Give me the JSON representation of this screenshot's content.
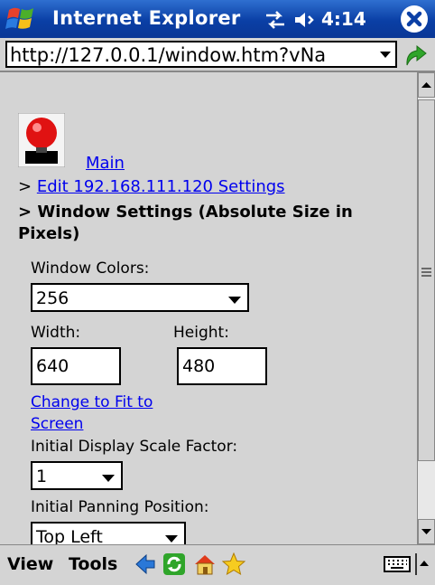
{
  "window": {
    "title": "Internet Explorer",
    "clock": "4:14"
  },
  "address": {
    "url": "http://127.0.0.1/window.htm?vNa"
  },
  "breadcrumb": {
    "main": "Main",
    "prefix": ">",
    "edit": "Edit 192.168.111.120 Settings",
    "current": "> Window Settings (Absolute Size in Pixels)"
  },
  "form": {
    "window_colors_label": "Window Colors:",
    "window_colors_value": "256",
    "width_label": "Width:",
    "width_value": "640",
    "height_label": "Height:",
    "height_value": "480",
    "fit_link_line1": "Change to Fit to",
    "fit_link_line2": "Screen",
    "scale_label": "Initial Display Scale Factor:",
    "scale_value": "1",
    "panning_label": "Initial Panning Position:",
    "panning_value": "Top Left"
  },
  "menubar": {
    "view": "View",
    "tools": "Tools"
  },
  "icons": [
    "windows-logo-icon",
    "connectivity-icon",
    "volume-icon",
    "close-icon",
    "go-icon",
    "back-icon",
    "refresh-icon",
    "home-icon",
    "favorites-icon",
    "keyboard-icon",
    "input-panel-arrow-icon"
  ]
}
